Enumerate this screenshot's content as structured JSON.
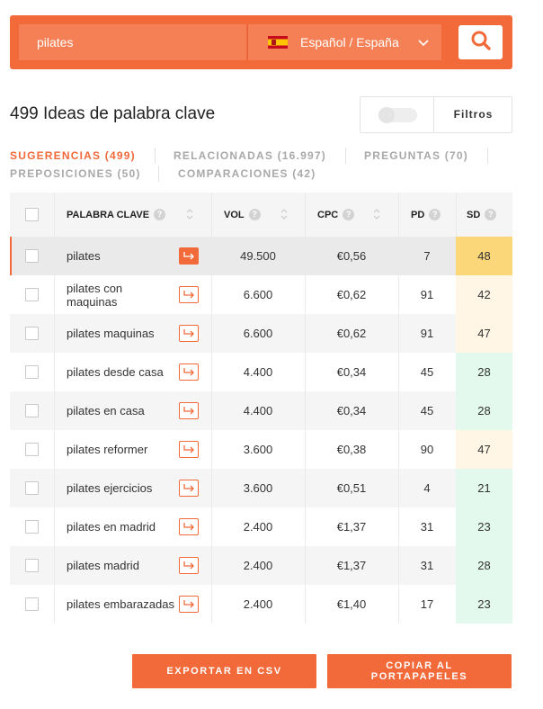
{
  "search": {
    "query": "pilates"
  },
  "language": {
    "label": "Español / España"
  },
  "ideas_title": "499 Ideas de palabra clave",
  "filters": {
    "label": "Filtros"
  },
  "tabs": [
    {
      "label": "SUGERENCIAS (499)"
    },
    {
      "label": "RELACIONADAS (16.997)"
    },
    {
      "label": "PREGUNTAS (70)"
    },
    {
      "label": "PREPOSICIONES (50)"
    },
    {
      "label": "COMPARACIONES (42)"
    }
  ],
  "table": {
    "headers": {
      "keyword": "PALABRA CLAVE",
      "vol": "VOL",
      "cpc": "CPC",
      "pd": "PD",
      "sd": "SD"
    },
    "rows": [
      {
        "keyword": "pilates",
        "vol": "49.500",
        "cpc": "€0,56",
        "pd": "7",
        "sd": "48",
        "sd_color": "#fcd77a"
      },
      {
        "keyword": "pilates con maquinas",
        "vol": "6.600",
        "cpc": "€0,62",
        "pd": "91",
        "sd": "42",
        "sd_color": "#fff6e6"
      },
      {
        "keyword": "pilates maquinas",
        "vol": "6.600",
        "cpc": "€0,62",
        "pd": "91",
        "sd": "47",
        "sd_color": "#fff6e6"
      },
      {
        "keyword": "pilates desde casa",
        "vol": "4.400",
        "cpc": "€0,34",
        "pd": "45",
        "sd": "28",
        "sd_color": "#e4f9ee"
      },
      {
        "keyword": "pilates en casa",
        "vol": "4.400",
        "cpc": "€0,34",
        "pd": "45",
        "sd": "28",
        "sd_color": "#e4f9ee"
      },
      {
        "keyword": "pilates reformer",
        "vol": "3.600",
        "cpc": "€0,38",
        "pd": "90",
        "sd": "47",
        "sd_color": "#fff6e6"
      },
      {
        "keyword": "pilates ejercicios",
        "vol": "3.600",
        "cpc": "€0,51",
        "pd": "4",
        "sd": "21",
        "sd_color": "#e4f9ee"
      },
      {
        "keyword": "pilates en madrid",
        "vol": "2.400",
        "cpc": "€1,37",
        "pd": "31",
        "sd": "23",
        "sd_color": "#e4f9ee"
      },
      {
        "keyword": "pilates madrid",
        "vol": "2.400",
        "cpc": "€1,37",
        "pd": "31",
        "sd": "28",
        "sd_color": "#e4f9ee"
      },
      {
        "keyword": "pilates embarazadas",
        "vol": "2.400",
        "cpc": "€1,40",
        "pd": "17",
        "sd": "23",
        "sd_color": "#e4f9ee"
      }
    ]
  },
  "buttons": {
    "export": "EXPORTAR EN CSV",
    "copy": "COPIAR AL PORTAPAPELES"
  },
  "colors": {
    "accent": "#f26a3a"
  }
}
